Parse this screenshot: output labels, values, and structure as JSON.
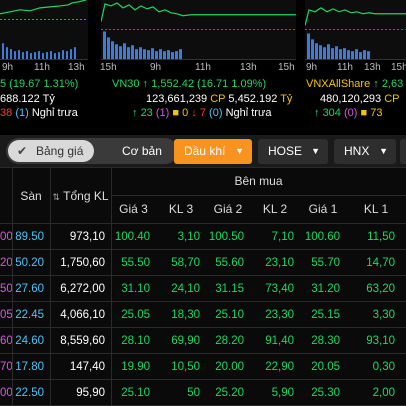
{
  "charts": {
    "time_labels": [
      "9h",
      "11h",
      "13h",
      "15h",
      "9h",
      "11h",
      "13h",
      "15h",
      "9h",
      "11h",
      "13h",
      "15h"
    ]
  },
  "indices": [
    {
      "name": "",
      "change": "5 (19.67 1.31%)",
      "value_line": "688.122 Tỷ",
      "breadth": {
        "up": "",
        "ref": "",
        "ref_ceil": "",
        "down": "38",
        "down_floor": "(1)"
      },
      "status": "Nghỉ trưa"
    },
    {
      "name": "VN30",
      "arrow": "↑",
      "price": "1,552.42",
      "change": "(16.71 1.09%)",
      "volume": "123,661,239",
      "volume_unit": "CP",
      "value": "5,452.192",
      "value_unit": "Tỷ",
      "breadth": {
        "up": "23",
        "up_ceil": "(1)",
        "ref": "0",
        "down": "7",
        "down_floor": "(0)"
      },
      "status": "Nghỉ trưa"
    },
    {
      "name": "VNXAllShare",
      "arrow": "↑",
      "price": "2,63",
      "volume": "480,120,293",
      "volume_unit": "CP",
      "value": "",
      "breadth": {
        "up": "304",
        "up_ceil": "(0)",
        "ref": "73"
      }
    }
  ],
  "toolbar": {
    "tab_active": "Bảng giá",
    "tab_other": "Cơ bản",
    "dropdowns": [
      {
        "label": "Dầu khí",
        "active": true
      },
      {
        "label": "HOSE",
        "active": false
      },
      {
        "label": "HNX",
        "active": false
      }
    ]
  },
  "table": {
    "group_header": "Bên mua",
    "columns": {
      "floor": "Sàn",
      "total_volume": "Tổng KL",
      "bid_price3": "Giá 3",
      "bid_vol3": "KL 3",
      "bid_price2": "Giá 2",
      "bid_vol2": "KL 2",
      "bid_price1": "Giá 1",
      "bid_vol1": "KL 1"
    },
    "rows": [
      {
        "ceil": "00",
        "floor": "89.50",
        "total": "973,10",
        "p3": "100.40",
        "v3": "3,10",
        "p2": "100.50",
        "v2": "7,10",
        "p1": "100.60",
        "v1": "11,50"
      },
      {
        "ceil": "20",
        "floor": "50.20",
        "total": "1,750,60",
        "p3": "55.50",
        "v3": "58,70",
        "p2": "55.60",
        "v2": "23,10",
        "p1": "55.70",
        "v1": "14,70"
      },
      {
        "ceil": "50",
        "floor": "27.60",
        "total": "6,272,00",
        "p3": "31.10",
        "v3": "24,10",
        "p2": "31.15",
        "v2": "73,40",
        "p1": "31.20",
        "v1": "63,20"
      },
      {
        "ceil": "05",
        "floor": "22.45",
        "total": "4,066,10",
        "p3": "25.05",
        "v3": "18,30",
        "p2": "25.10",
        "v2": "23,30",
        "p1": "25.15",
        "v1": "3,30"
      },
      {
        "ceil": "60",
        "floor": "24.60",
        "total": "8,559,60",
        "p3": "28.10",
        "v3": "69,90",
        "p2": "28.20",
        "v2": "91,40",
        "p1": "28.30",
        "v1": "93,10"
      },
      {
        "ceil": "70",
        "floor": "17.80",
        "total": "147,40",
        "p3": "19.90",
        "v3": "10,50",
        "p2": "20.00",
        "v2": "22,90",
        "p1": "20.05",
        "v1": "0,30"
      },
      {
        "ceil": "00",
        "floor": "22.50",
        "total": "95,90",
        "p3": "25.10",
        "v3": "50",
        "p2": "25.20",
        "v2": "5,90",
        "p1": "25.30",
        "v1": "2,00"
      }
    ]
  },
  "colors": {
    "up": "#1ed760",
    "reference": "#f5c400",
    "down": "#ff3b30",
    "ceiling": "#d25bd6",
    "floor": "#4fc3f7",
    "accent": "#f7931e"
  }
}
